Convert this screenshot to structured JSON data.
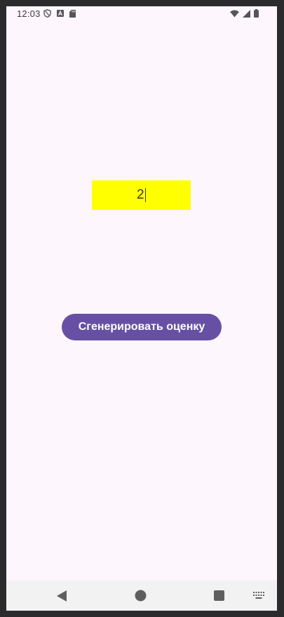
{
  "status_bar": {
    "time": "12:03",
    "left_icons": [
      "shield-icon",
      "font-a-icon",
      "sd-card-icon"
    ],
    "right_icons": [
      "wifi-icon",
      "cellular-signal-icon",
      "battery-icon"
    ]
  },
  "grade_field": {
    "value": "2",
    "background_color": "#ffff00"
  },
  "generate_button": {
    "label": "Сгенерировать оценку",
    "color": "#6750a4"
  },
  "navigation_bar": {
    "icons": [
      "back-icon",
      "home-icon",
      "recents-icon",
      "keyboard-icon"
    ]
  },
  "colors": {
    "screen_background": "#fdf6fd",
    "frame": "#2b2b2d"
  }
}
